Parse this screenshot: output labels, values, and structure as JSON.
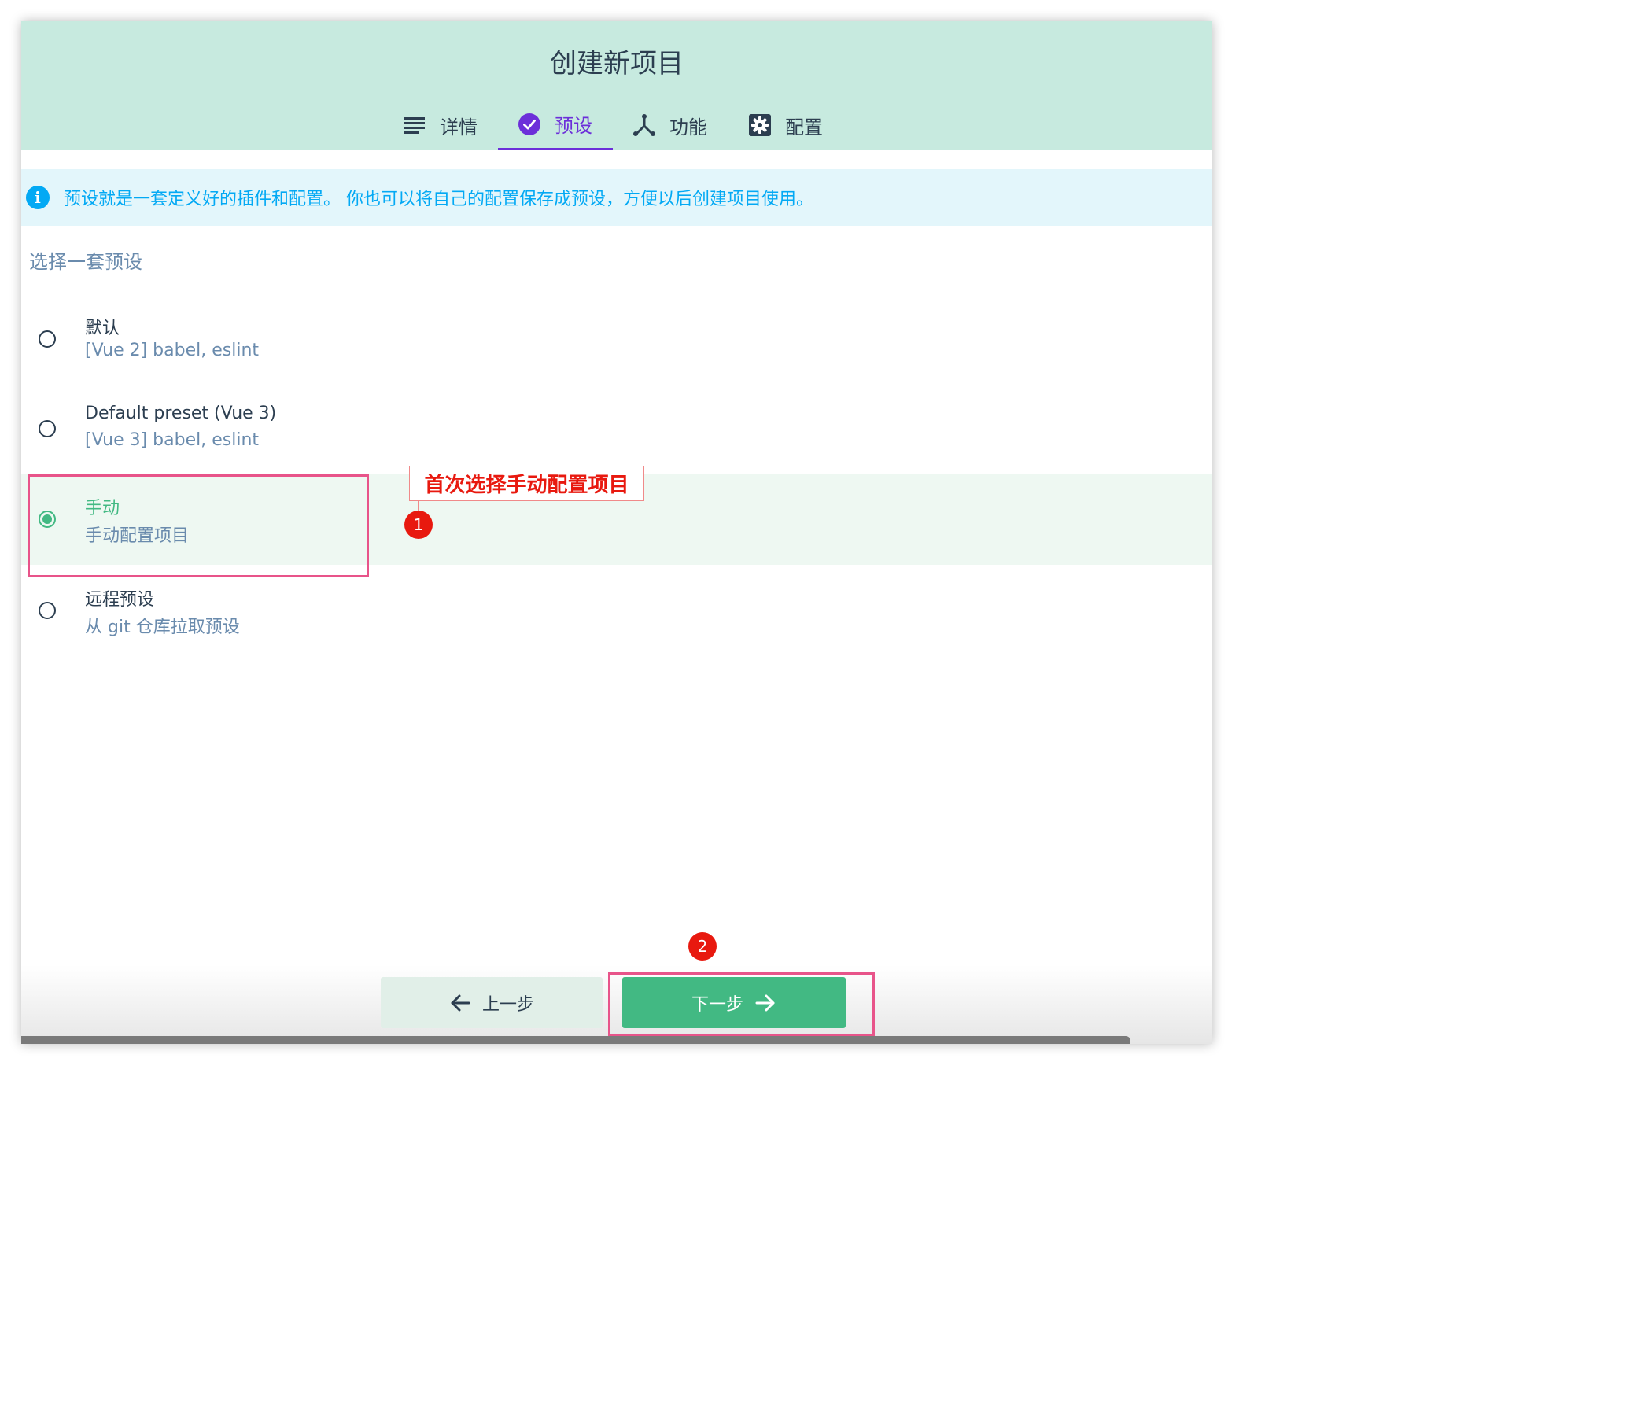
{
  "header": {
    "title": "创建新项目",
    "tabs": [
      {
        "label": "详情",
        "icon": "list-icon"
      },
      {
        "label": "预设",
        "icon": "check-circle-icon",
        "active": true
      },
      {
        "label": "功能",
        "icon": "fork-icon"
      },
      {
        "label": "配置",
        "icon": "gear-icon"
      }
    ]
  },
  "info": {
    "icon": "info-icon",
    "text": "预设就是一套定义好的插件和配置。 你也可以将自己的配置保存成预设，方便以后创建项目使用。"
  },
  "section_title": "选择一套预设",
  "options": [
    {
      "name": "默认",
      "desc": "[Vue 2] babel, eslint",
      "selected": false
    },
    {
      "name": "Default preset (Vue 3)",
      "desc": "[Vue 3] babel, eslint",
      "selected": false
    },
    {
      "name": "手动",
      "desc": "手动配置项目",
      "selected": true
    },
    {
      "name": "远程预设",
      "desc": "从 git 仓库拉取预设",
      "selected": false
    }
  ],
  "annotation": {
    "label": "首次选择手动配置项目",
    "badge1": "1",
    "badge2": "2"
  },
  "buttons": {
    "prev": "上一步",
    "next": "下一步"
  },
  "colors": {
    "header_bg": "#c7eadf",
    "accent": "#6c2fd9",
    "green": "#42b983",
    "info": "#03a9f4",
    "annotation": "#e8190f"
  }
}
